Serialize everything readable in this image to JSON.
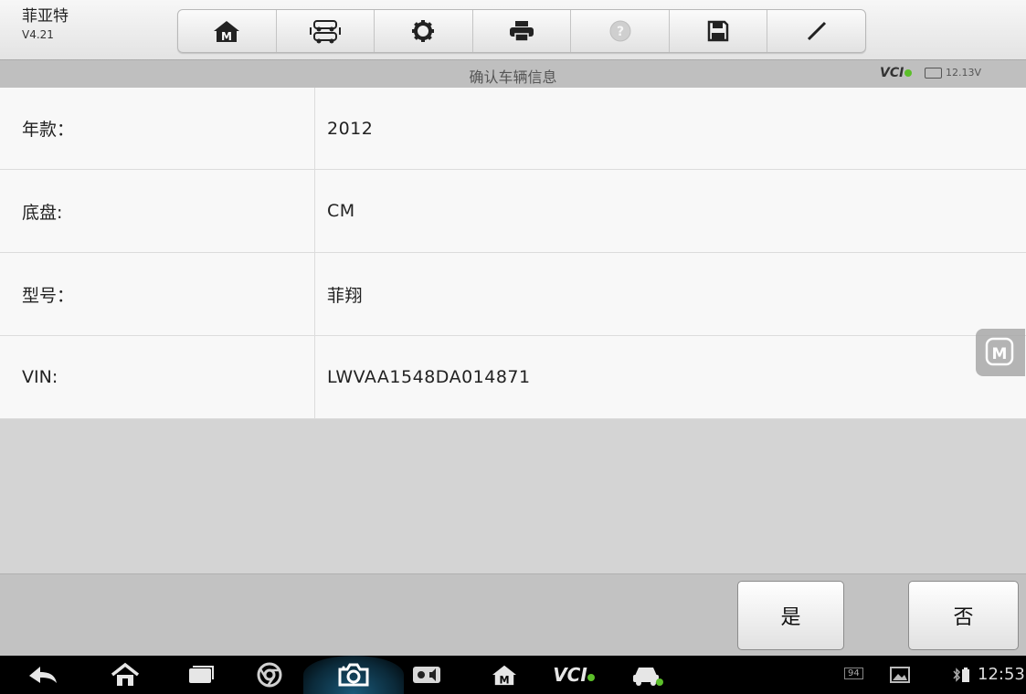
{
  "app": {
    "title": "菲亚特",
    "version": "V4.21"
  },
  "toolbar": {
    "buttons": [
      "home-icon",
      "vehicle-swap-icon",
      "gear-icon",
      "printer-icon",
      "help-icon",
      "save-icon",
      "pen-icon"
    ]
  },
  "titlebar": {
    "title": "确认车辆信息",
    "vci_label": "VCI",
    "battery_voltage": "12.13V"
  },
  "vehicle_info": [
    {
      "label": "年款：",
      "value": "2012"
    },
    {
      "label": "底盘:",
      "value": "CM"
    },
    {
      "label": "型号：",
      "value": "菲翔"
    },
    {
      "label": "VIN:",
      "value": "LWVAA1548DA014871"
    }
  ],
  "actions": {
    "yes_label": "是",
    "no_label": "否"
  },
  "statusbar": {
    "time": "12:53",
    "notification_count": "94"
  },
  "navbar": {
    "icons": [
      "back-icon",
      "home-icon",
      "recent-apps-icon",
      "browser-icon",
      "camera-icon",
      "display-settings-icon",
      "maxisys-home-icon",
      "vci-icon",
      "car-connect-icon"
    ],
    "vci_label": "VCI"
  },
  "colors": {
    "vci_ok": "#5cbf2a",
    "toolbar_icon": "#222222"
  }
}
